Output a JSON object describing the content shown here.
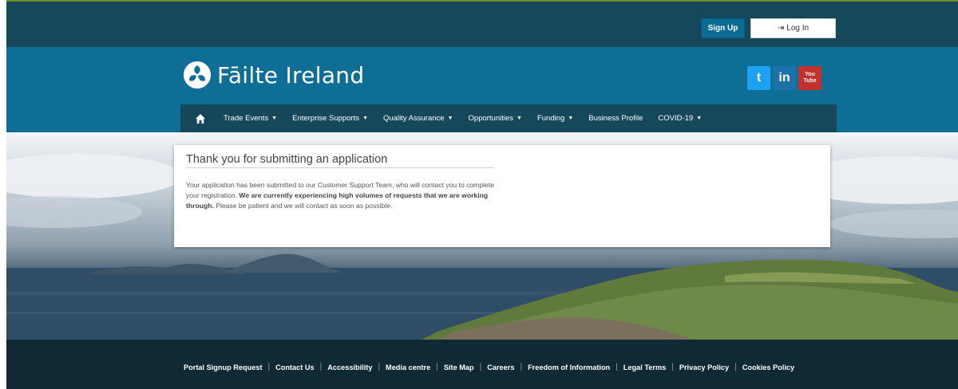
{
  "auth": {
    "signup_label": "Sign Up",
    "login_label": "Log In",
    "login_icon": "sign-in-icon"
  },
  "brand": {
    "name": "Fāilte Ireland",
    "logo_icon": "failte-ireland-logo"
  },
  "social": [
    {
      "name": "twitter",
      "glyph": "t"
    },
    {
      "name": "linkedin",
      "glyph": "in"
    },
    {
      "name": "youtube",
      "glyph_top": "You",
      "glyph_bottom": "Tube"
    }
  ],
  "nav": {
    "home_icon": "home-icon",
    "items": [
      {
        "label": "Trade Events",
        "has_dropdown": true
      },
      {
        "label": "Enterprise Supports",
        "has_dropdown": true
      },
      {
        "label": "Quality Assurance",
        "has_dropdown": true
      },
      {
        "label": "Opportunities",
        "has_dropdown": true
      },
      {
        "label": "Funding",
        "has_dropdown": true
      },
      {
        "label": "Business Profile",
        "has_dropdown": false
      },
      {
        "label": "COVID-19",
        "has_dropdown": true
      }
    ]
  },
  "message": {
    "title": "Thank you for submitting an application",
    "body_part1": "Your application has been submitted to our Customer Support Team, who will contact you to complete your registration. ",
    "body_bold": "We are currently experiencing high volumes of requests that we are working through.",
    "body_part2": " Please be patient and we will contact as soon as possible."
  },
  "footer": {
    "links": [
      "Portal Signup Request",
      "Contact Us",
      "Accessibility",
      "Media centre",
      "Site Map",
      "Careers",
      "Freedom of Information",
      "Legal Terms",
      "Privacy Policy",
      "Cookies Policy"
    ]
  },
  "colors": {
    "auth_bar": "#16485c",
    "brand_header": "#0f6e96",
    "nav_bar": "#16485c",
    "signup_button": "#0b6d96",
    "footer": "#0f2a35"
  }
}
